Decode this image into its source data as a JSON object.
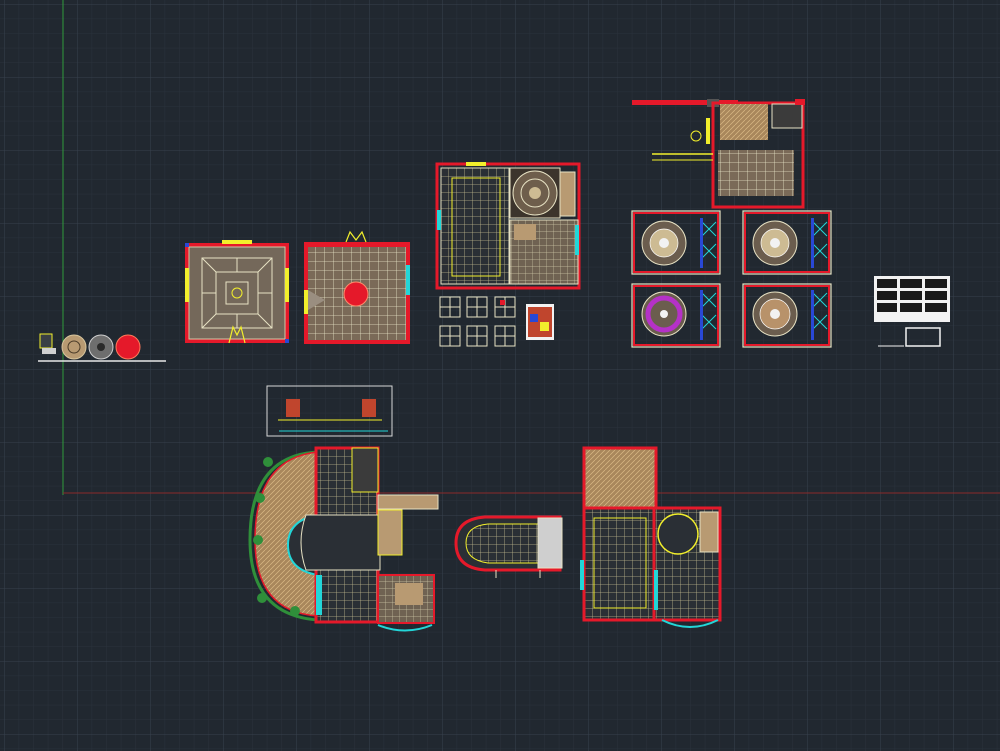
{
  "viewport": {
    "background": "#212830",
    "grid_minor_color": "#2b333d",
    "grid_major_color": "#36404c",
    "axis_y_color": "#2f9a3a",
    "axis_x_color": "#8a2a2a"
  },
  "colors": {
    "wall": "#e5192a",
    "beam": "#f2ef2c",
    "glass": "#23d6d8",
    "floor": "#74685a",
    "line": "#d8d8d8",
    "wood": "#b89a72",
    "tan": "#c8a26a",
    "blue": "#2948d6",
    "purple": "#b531c7",
    "green": "#2f8f3a",
    "white": "#f2f2f2"
  },
  "drawing_blocks": [
    "legend-block",
    "ceiling-plan-square-a",
    "ceiling-plan-square-b",
    "ceiling-plan-hall",
    "detail-grid",
    "perspective-sheet",
    "dome-room-1",
    "dome-room-2",
    "dome-room-3",
    "dome-room-4",
    "title-block-sheet",
    "section-elevation",
    "plan-curved-wing",
    "plan-capsule",
    "plan-large-east"
  ]
}
